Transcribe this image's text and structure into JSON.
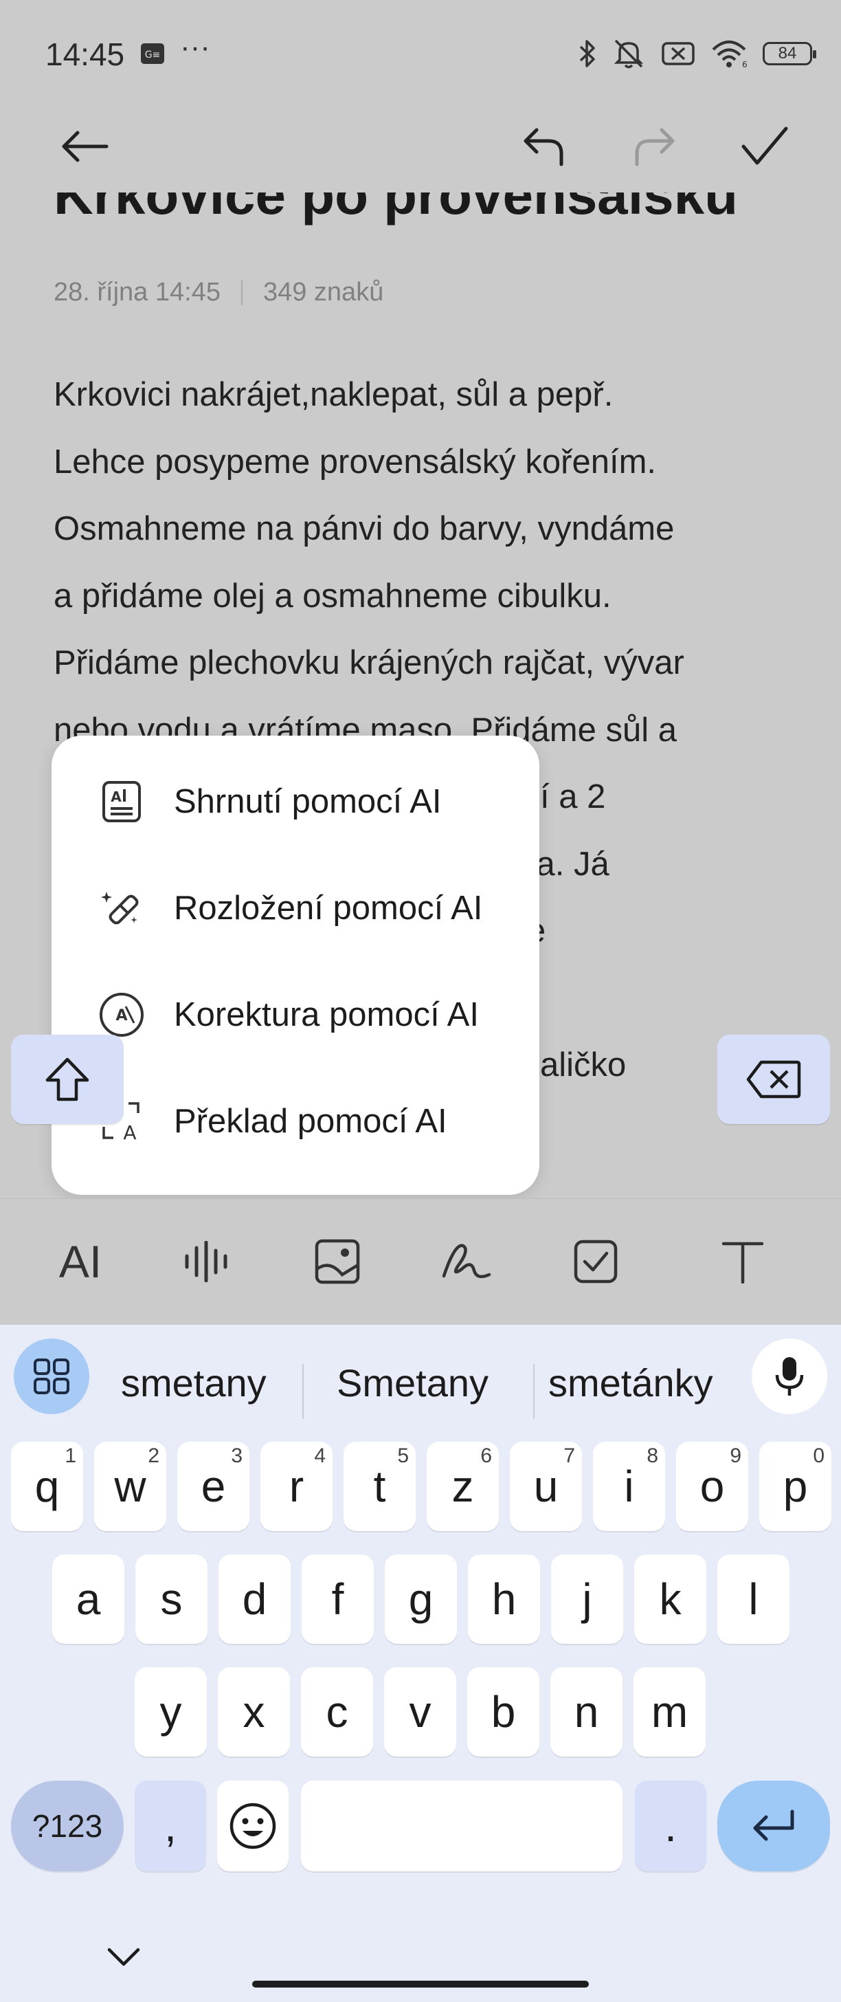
{
  "status_bar": {
    "time": "14:45",
    "dots": "···",
    "battery": "84",
    "icons": [
      "notification-app-icon",
      "bluetooth-icon",
      "mute-icon",
      "no-sim-icon",
      "wifi-icon",
      "battery-icon"
    ]
  },
  "toolbar": {
    "back_icon": "arrow-left-icon",
    "undo_icon": "undo-icon",
    "redo_icon": "redo-icon",
    "done_icon": "check-icon"
  },
  "note": {
    "title": "Krkovice po provensálsku",
    "date": "28. října 14:45",
    "char_count": "349 znaků",
    "body": "Krkovici nakrájet,naklepat, sůl a pepř.\nLehce posypeme provensálský kořením.\nOsmahneme na pánvi do barvy, vyndáme\na přidáme olej a osmahneme cibulku.\nPřidáme plechovku krájených rajčat, vývar\nnebo vodu a vrátíme maso. Přidáme sůl a\n                                        o koření a 2\n                                        o měkka. Já\n                                       maso se\n                                       é, tak\n                                       dáme maličko"
  },
  "ai_menu": {
    "items": [
      {
        "label": "Shrnutí pomocí AI",
        "icon": "ai-summary-icon"
      },
      {
        "label": "Rozložení pomocí AI",
        "icon": "magic-wand-icon"
      },
      {
        "label": "Korektura pomocí AI",
        "icon": "ai-proofread-icon"
      },
      {
        "label": "Překlad pomocí AI",
        "icon": "translate-icon"
      }
    ]
  },
  "format_bar": {
    "ai_label": "AI",
    "icons": [
      "ai-icon",
      "audio-waveform-icon",
      "image-icon",
      "handwriting-icon",
      "checklist-icon",
      "text-format-icon"
    ]
  },
  "keyboard": {
    "suggestions": [
      "smetany",
      "Smetany",
      "smetánky"
    ],
    "row1": [
      {
        "k": "q",
        "n": "1"
      },
      {
        "k": "w",
        "n": "2"
      },
      {
        "k": "e",
        "n": "3"
      },
      {
        "k": "r",
        "n": "4"
      },
      {
        "k": "t",
        "n": "5"
      },
      {
        "k": "z",
        "n": "6"
      },
      {
        "k": "u",
        "n": "7"
      },
      {
        "k": "i",
        "n": "8"
      },
      {
        "k": "o",
        "n": "9"
      },
      {
        "k": "p",
        "n": "0"
      }
    ],
    "row2": [
      "a",
      "s",
      "d",
      "f",
      "g",
      "h",
      "j",
      "k",
      "l"
    ],
    "row3": [
      "y",
      "x",
      "c",
      "v",
      "b",
      "n",
      "m"
    ],
    "symbols_label": "?123",
    "comma": ",",
    "period": "."
  }
}
